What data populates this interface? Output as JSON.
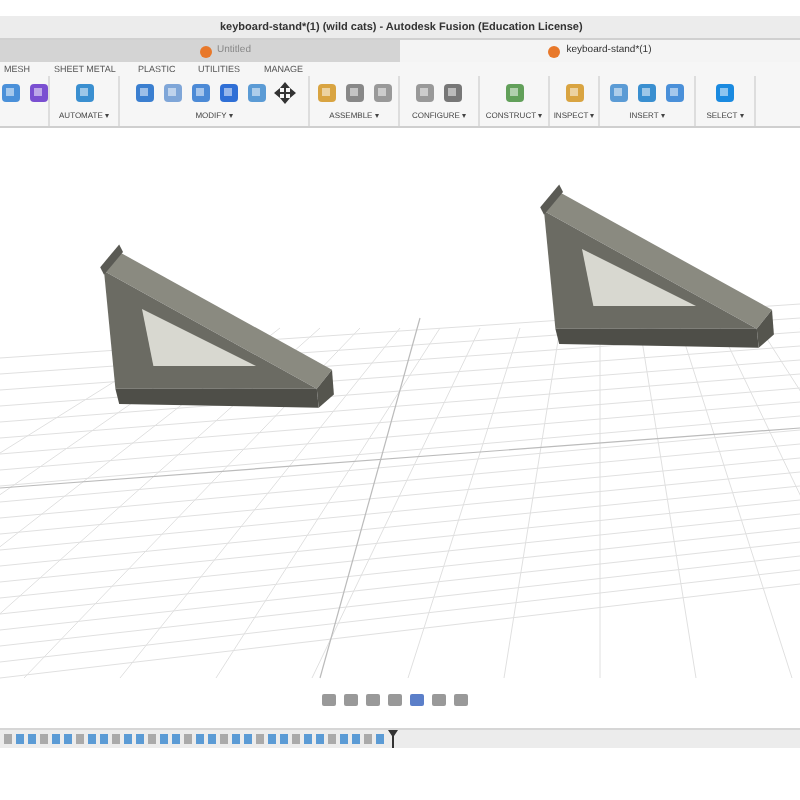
{
  "window": {
    "title": "keyboard-stand*(1) (wild cats) - Autodesk Fusion (Education License)"
  },
  "document_tabs": [
    {
      "label": "Untitled",
      "selected": false
    },
    {
      "label": "keyboard-stand*(1)",
      "selected": true
    }
  ],
  "ribbon_tabs": [
    {
      "label": "MESH",
      "selected": false
    },
    {
      "label": "SHEET METAL",
      "selected": false
    },
    {
      "label": "PLASTIC",
      "selected": false
    },
    {
      "label": "UTILITIES",
      "selected": false
    },
    {
      "label": "MANAGE",
      "selected": false
    }
  ],
  "toolbar_groups": [
    {
      "label": "AUTOMATE ▾"
    },
    {
      "label": "MODIFY ▾"
    },
    {
      "label": "ASSEMBLE ▾"
    },
    {
      "label": "CONFIGURE ▾"
    },
    {
      "label": "CONSTRUCT ▾"
    },
    {
      "label": "INSPECT ▾"
    },
    {
      "label": "INSERT ▾"
    },
    {
      "label": "SELECT ▾"
    }
  ]
}
